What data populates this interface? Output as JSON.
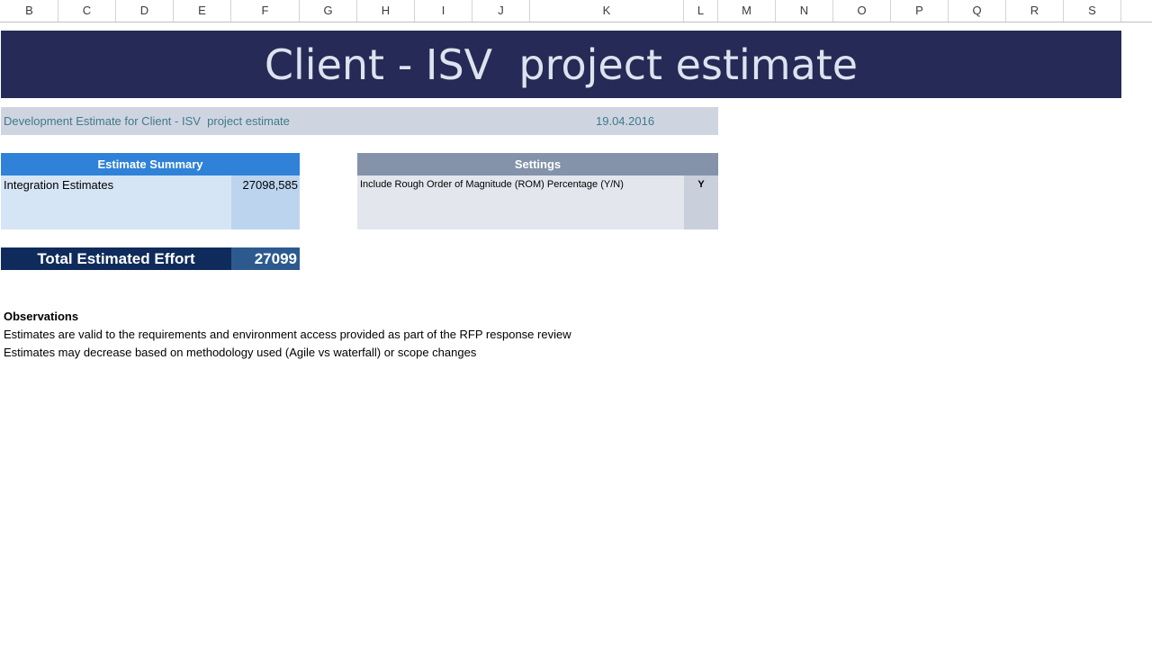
{
  "columns": [
    "B",
    "C",
    "D",
    "E",
    "F",
    "G",
    "H",
    "I",
    "J",
    "K",
    "L",
    "M",
    "N",
    "O",
    "P",
    "Q",
    "R",
    "S"
  ],
  "title": "Client - ISV  project estimate",
  "subtitle": {
    "text": "Development Estimate for Client - ISV  project estimate",
    "date": "19.04.2016"
  },
  "estimate_summary": {
    "header": "Estimate Summary",
    "rows": [
      {
        "label": "Integration Estimates",
        "value": "27098,585"
      }
    ]
  },
  "total": {
    "label": "Total Estimated Effort",
    "value": "27099"
  },
  "settings": {
    "header": "Settings",
    "rows": [
      {
        "label": "Include Rough Order of Magnitude (ROM) Percentage (Y/N)",
        "value": "Y"
      }
    ]
  },
  "observations": {
    "title": "Observations",
    "lines": [
      "Estimates are valid to the requirements and environment access provided as part of the RFP response review",
      "Estimates may decrease based on methodology used (Agile vs waterfall) or scope changes"
    ]
  },
  "colors": {
    "title_banner": "#252a56",
    "summary_header": "#2f82d8",
    "total_label": "#0f2b5c",
    "settings_header": "#8492aa"
  }
}
